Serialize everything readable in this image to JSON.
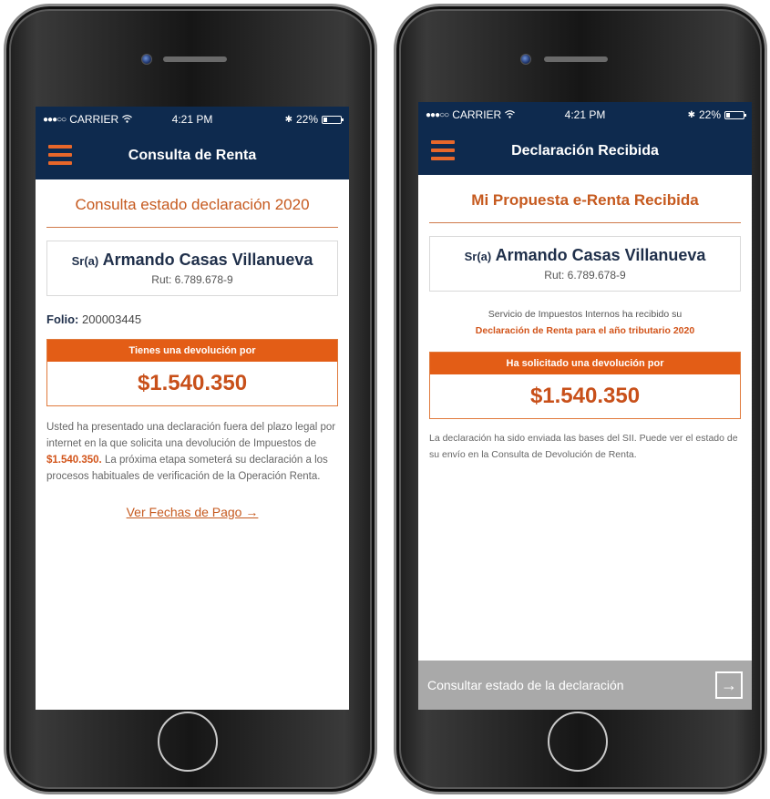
{
  "colors": {
    "navy": "#0e2a4e",
    "accent_orange": "#e35d16",
    "title_orange": "#c65a1f",
    "bottom_bar_gray": "#a9a9a9"
  },
  "left": {
    "status": {
      "carrier": "CARRIER",
      "time": "4:21 PM",
      "battery": "22%",
      "battery_level": 0.22
    },
    "nav": {
      "title": "Consulta de Renta",
      "menu_icon": "hamburger-icon"
    },
    "section_title": "Consulta estado declaración 2020",
    "taxpayer": {
      "prefix": "Sr(a)",
      "name": "Armando Casas Villanueva",
      "rut": "Rut: 6.789.678-9"
    },
    "folio": {
      "label": "Folio:",
      "value": "200003445"
    },
    "refund": {
      "header": "Tienes una devolución por",
      "amount": "$1.540.350"
    },
    "paragraph": {
      "part1": "Usted ha presentado una declaración fuera del plazo legal por internet en la que solicita una devolución de Impuestos de ",
      "highlight": "$1.540.350.",
      "part2": " La próxima etapa someterá su declaración a los procesos habituales de verificación de la Operación Renta."
    },
    "link": "Ver Fechas de Pago →"
  },
  "right": {
    "status": {
      "carrier": "CARRIER",
      "time": "4:21 PM",
      "battery": "22%",
      "battery_level": 0.22
    },
    "nav": {
      "title": "Declaración Recibida",
      "menu_icon": "hamburger-icon"
    },
    "section_title": "Mi Propuesta e-Renta Recibida",
    "taxpayer": {
      "prefix": "Sr(a)",
      "name": "Armando Casas Villanueva",
      "rut": "Rut: 6.789.678-9"
    },
    "notice": {
      "line1": "Servicio de Impuestos Internos ha recibido su",
      "line2": "Declaración de Renta para el año tributario 2020"
    },
    "refund": {
      "header": "Ha solicitado una devolución por",
      "amount": "$1.540.350"
    },
    "paragraph": "La declaración ha sido enviada las bases del SII. Puede ver el estado de su envío en la Consulta de Devolución de Renta.",
    "bottom_button": {
      "label": "Consultar estado de la declaración",
      "icon": "exit-arrow-icon"
    }
  }
}
